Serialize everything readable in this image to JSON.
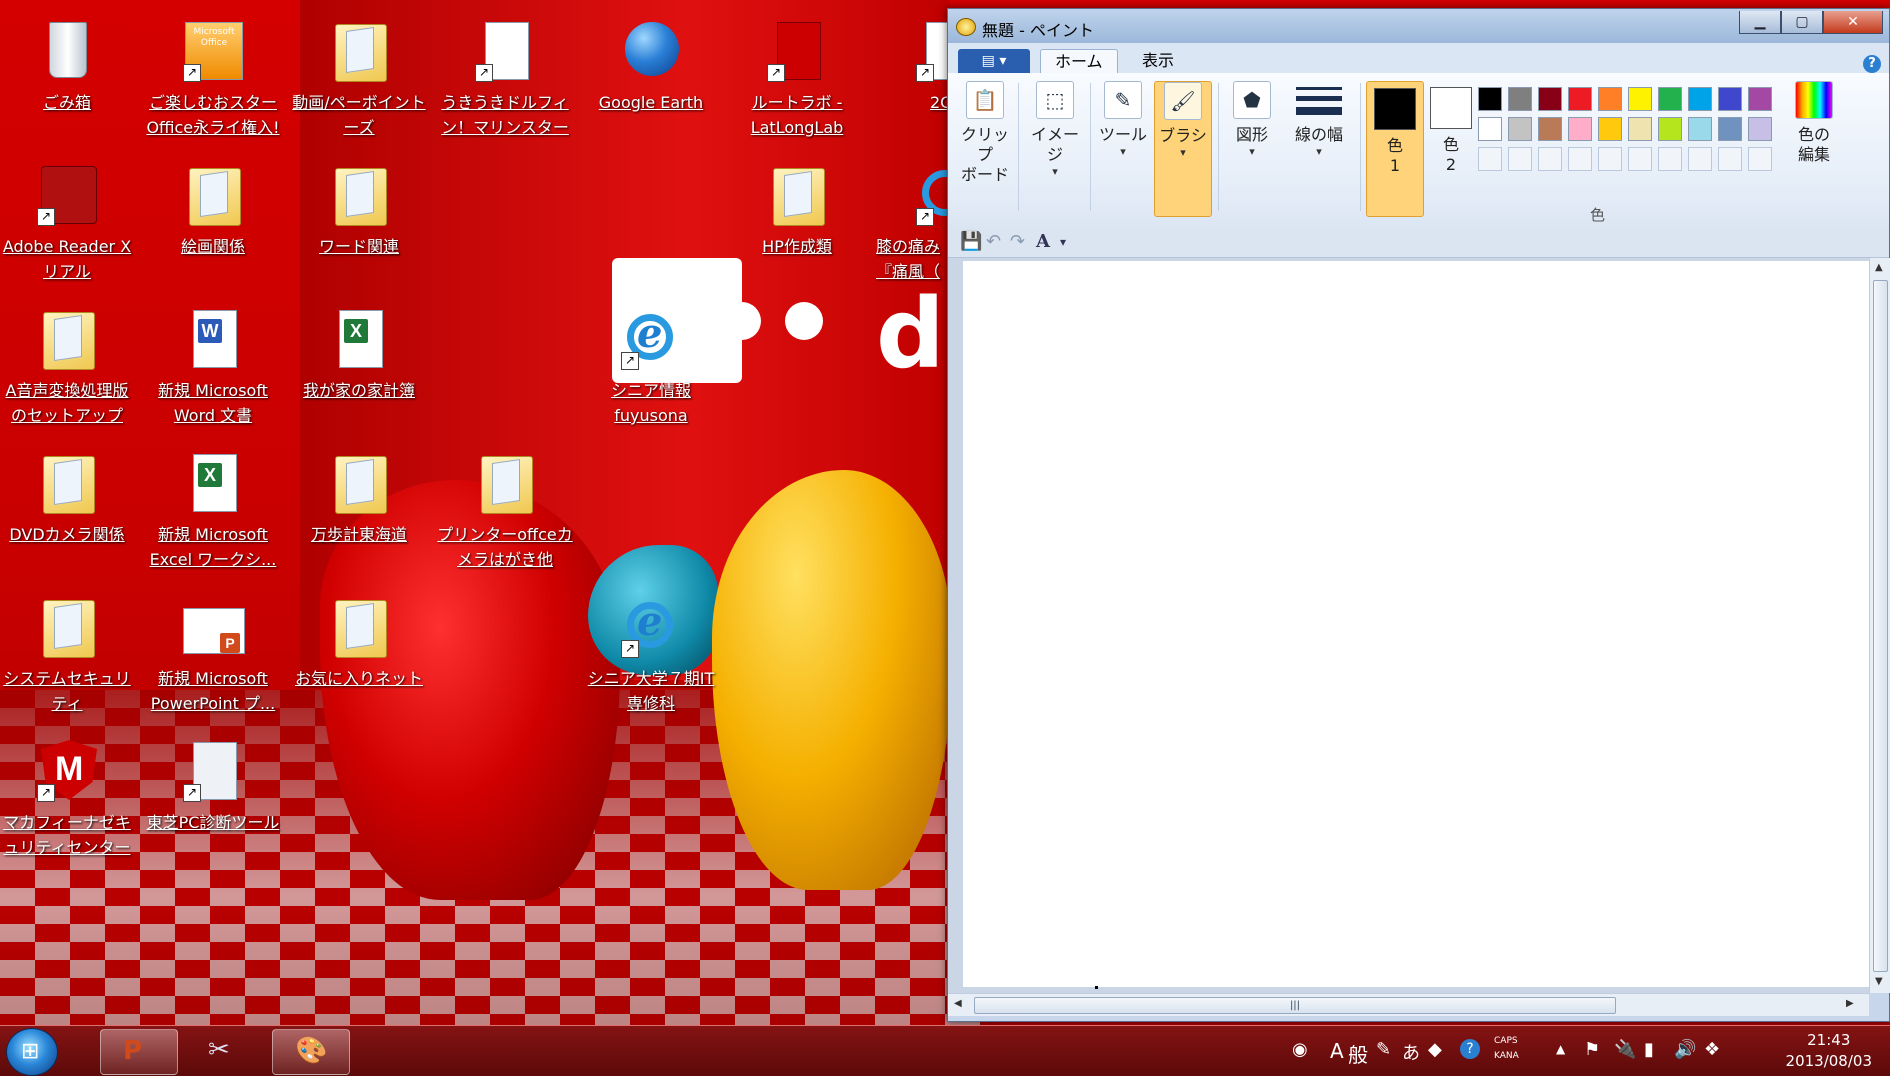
{
  "desktop": {
    "icons": [
      {
        "label": "ごみ箱"
      },
      {
        "label": "ご楽しむおスター\nOffice永ライ権入!"
      },
      {
        "label": "動画/ペーボイント\nーズ"
      },
      {
        "label": "うきうきドルフィ\nン！マリンスター"
      },
      {
        "label": "Google Earth"
      },
      {
        "label": "ルートラボ -\nLatLongLab"
      },
      {
        "label": "2C"
      },
      {
        "label": "Adobe Reader X\nリアル"
      },
      {
        "label": "絵画関係"
      },
      {
        "label": "ワード関連"
      },
      {
        "label": "HP作成類"
      },
      {
        "label": "膝の痛み\n『痛風（"
      },
      {
        "label": "A音声変換処理版\nのセットアップ"
      },
      {
        "label": "新規 Microsoft\nWord 文書"
      },
      {
        "label": "我が家の家計簿"
      },
      {
        "label": "シニア情報\nfuyusona"
      },
      {
        "label": "DVDカメラ関係"
      },
      {
        "label": "新規 Microsoft\nExcel ワークシ..."
      },
      {
        "label": "万歩計東海道"
      },
      {
        "label": "プリンターoffceカ\nメラはがき他"
      },
      {
        "label": "システムセキュリ\nティ"
      },
      {
        "label": "新規 Microsoft\nPowerPoint プ..."
      },
      {
        "label": "お気に入りネット"
      },
      {
        "label": "シニア大学７期IT\n専修科"
      },
      {
        "label": "マカフィーナゼキ\nュリティセンター"
      },
      {
        "label": "東芝PC診断ツール"
      }
    ],
    "office_icon_text": "Microsoft\nOffice"
  },
  "paint": {
    "title": "無題 - ペイント",
    "file_menu": "▤ ▾",
    "tabs": [
      {
        "label": "ホーム"
      },
      {
        "label": "表示"
      }
    ],
    "ribbon": {
      "clipboard": "クリップ\nボード",
      "image": "イメージ",
      "tools": "ツール",
      "brush": "ブラシ",
      "shapes": "図形",
      "line_width": "線の幅",
      "color1": "色\n1",
      "color2": "色\n2",
      "colors_caption": "色",
      "edit_colors": "色の\n編集"
    },
    "palette_row1": [
      "#000000",
      "#7f7f7f",
      "#880015",
      "#ed1c24",
      "#ff7f27",
      "#fff200",
      "#22b14c",
      "#00a2e8",
      "#3f48cc",
      "#a349a4"
    ],
    "palette_row2": [
      "#ffffff",
      "#c3c3c3",
      "#b97a57",
      "#ffaec9",
      "#ffc90e",
      "#efe4b0",
      "#b5e61d",
      "#99d9ea",
      "#7092be",
      "#c8bfe7"
    ],
    "color1_value": "#000000",
    "color2_value": "#ffffff",
    "help": "?"
  },
  "taskbar": {
    "tray": {
      "ime_mode": "A",
      "ime_kind": "般",
      "caps": "CAPS",
      "kana": "KANA"
    },
    "clock_time": "21:43",
    "clock_date": "2013/08/03"
  }
}
